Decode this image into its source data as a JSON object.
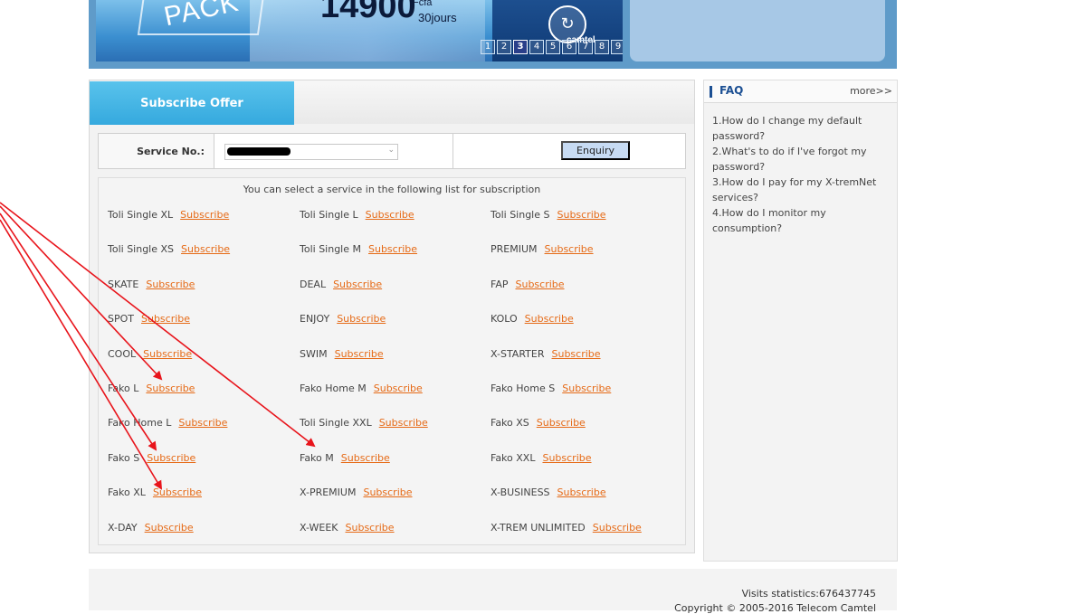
{
  "banner": {
    "pack_text": "PACK",
    "price": "14900",
    "price_unit": "Fcfa",
    "price_days": "30jours",
    "brand": "camtel",
    "pager": [
      "1",
      "2",
      "3",
      "4",
      "5",
      "6",
      "7",
      "8",
      "9"
    ],
    "pager_active": "3"
  },
  "offer": {
    "tab_label": "Subscribe Offer",
    "service_label": "Service No.:",
    "enquiry_label": "Enquiry",
    "list_heading": "You can select a service in the following list for subscription",
    "subscribe_label": "Subscribe",
    "services": [
      "Toli Single XL",
      "Toli Single L",
      "Toli Single S",
      "Toli Single XS",
      "Toli Single M",
      "PREMIUM",
      "SKATE",
      "DEAL",
      "FAP",
      "SPOT",
      "ENJOY",
      "KOLO",
      "COOL",
      "SWIM",
      "X-STARTER",
      "Fako L",
      "Fako Home M",
      "Fako Home S",
      "Fako Home L",
      "Toli Single XXL",
      "Fako XS",
      "Fako S",
      "Fako M",
      "Fako XXL",
      "Fako XL",
      "X-PREMIUM",
      "X-BUSINESS",
      "X-DAY",
      "X-WEEK",
      "X-TREM UNLIMITED"
    ]
  },
  "faq": {
    "title": "FAQ",
    "more": "more>>",
    "items": [
      "1.How do I change my default password?",
      "2.What's to do if I've forgot my password?",
      "3.How do I pay for my X-tremNet services?",
      "4.How do I monitor my consumption?"
    ]
  },
  "footer": {
    "stats": "Visits statistics:676437745",
    "copyright": "Copyright © 2005-2016 Telecom Camtel"
  },
  "annotation": {
    "arrow_color": "#e8141b"
  }
}
